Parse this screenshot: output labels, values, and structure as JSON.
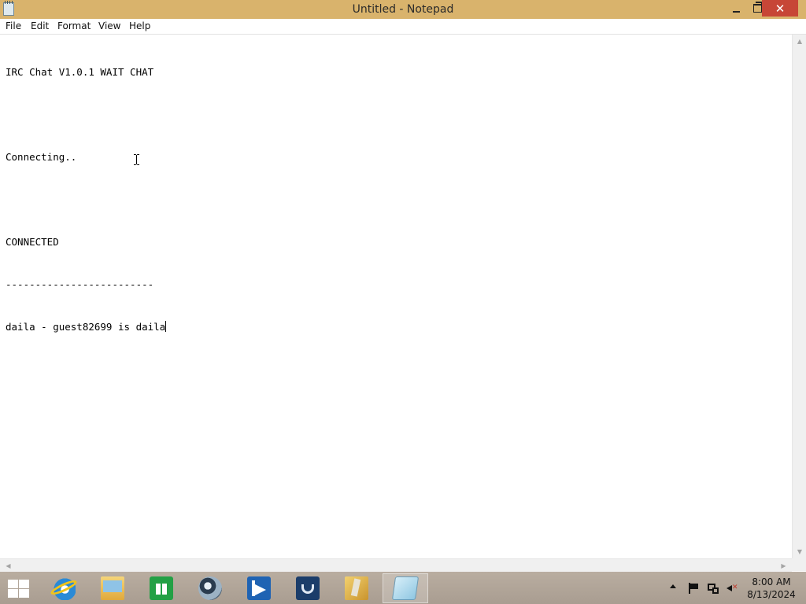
{
  "window": {
    "title": "Untitled - Notepad",
    "icon": "notepad-icon",
    "controls": {
      "minimize": "minimize-icon",
      "maximize": "restore-icon",
      "close": "✕"
    },
    "close_color": "#c74637"
  },
  "menu": {
    "items": [
      "File",
      "Edit",
      "Format",
      "View",
      "Help"
    ]
  },
  "editor": {
    "lines": [
      "IRC Chat V1.0.1 WAIT CHAT",
      "",
      "Connecting..",
      "",
      "CONNECTED",
      "-------------------------",
      "daila - guest82699 is daila"
    ]
  },
  "taskbar": {
    "apps": [
      {
        "name": "internet-explorer-icon",
        "active": false
      },
      {
        "name": "file-explorer-icon",
        "active": false
      },
      {
        "name": "store-icon",
        "active": false
      },
      {
        "name": "globe-app-icon",
        "active": false
      },
      {
        "name": "filezilla-icon",
        "active": false
      },
      {
        "name": "steam-icon",
        "active": false
      },
      {
        "name": "folder-app-icon",
        "active": false
      },
      {
        "name": "notepad-icon",
        "active": true
      }
    ],
    "tray": {
      "icons": [
        "show-hidden-icons-icon",
        "action-center-flag-icon",
        "network-icon",
        "volume-muted-icon"
      ],
      "time": "8:00 AM",
      "date": "8/13/2024"
    }
  }
}
